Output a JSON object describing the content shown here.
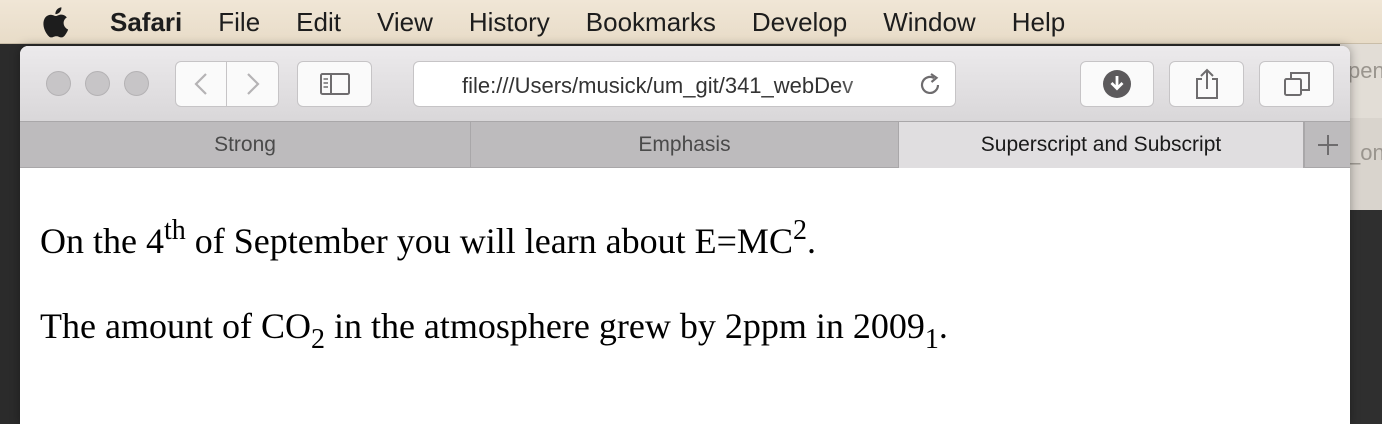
{
  "menubar": {
    "apple_icon": "apple-logo-icon",
    "items": [
      "Safari",
      "File",
      "Edit",
      "View",
      "History",
      "Bookmarks",
      "Develop",
      "Window",
      "Help"
    ]
  },
  "background_window": {
    "text_top": "pen",
    "text_tab": "_on"
  },
  "toolbar": {
    "icons": [
      "back-chevron-icon",
      "forward-chevron-icon",
      "sidebar-icon",
      "reload-icon",
      "download-icon",
      "share-icon",
      "tabs-overview-icon"
    ],
    "url": "file:///Users/musick/um_git/341_webDev"
  },
  "tabs": [
    {
      "label": "Strong",
      "active": false
    },
    {
      "label": "Emphasis",
      "active": false
    },
    {
      "label": "Superscript and Subscript",
      "active": true
    }
  ],
  "content": {
    "line1": {
      "pre": "On the 4",
      "sup1": "th",
      "mid": " of September you will learn about E=MC",
      "sup2": "2",
      "post": "."
    },
    "line2": {
      "pre": "The amount of CO",
      "sub1": "2",
      "mid": " in the atmosphere grew by 2ppm in 2009",
      "sub2": "1",
      "post": "."
    }
  }
}
